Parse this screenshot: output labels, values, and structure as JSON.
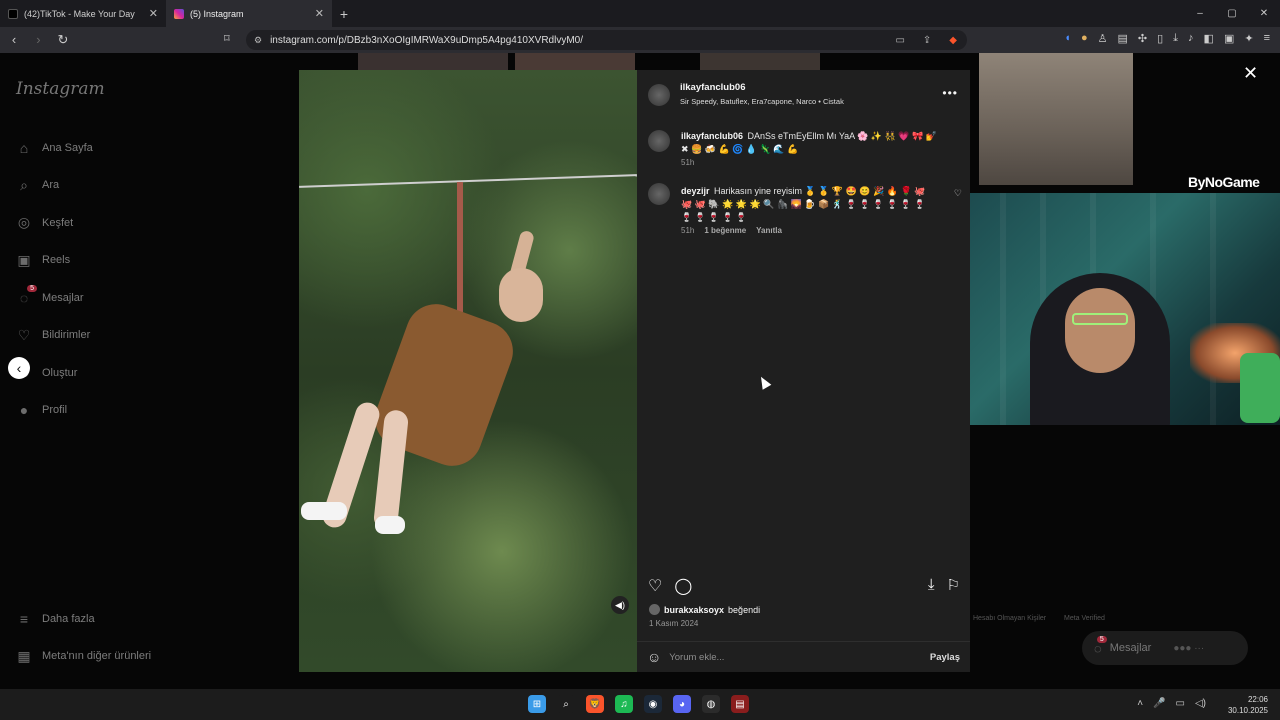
{
  "browser": {
    "tabs": [
      {
        "title": "(42)TikTok - Make Your Day",
        "favicon_color": "#000000",
        "active": false
      },
      {
        "title": "(5) Instagram",
        "favicon_color": "#d6249f",
        "active": true
      }
    ],
    "new_tab": "+",
    "url": "instagram.com/p/DBzb3nXoOIgIMRWaX9uDmp5A4pg410XVRdlvyM0/",
    "window_controls": {
      "minimize": "–",
      "maximize": "▢",
      "close": "✕"
    }
  },
  "sidebar": {
    "logo": "Instagram",
    "items": [
      {
        "label": "Ana Sayfa",
        "icon": "home-icon",
        "glyph": "⌂"
      },
      {
        "label": "Ara",
        "icon": "search-icon",
        "glyph": "⌕"
      },
      {
        "label": "Keşfet",
        "icon": "compass-icon",
        "glyph": "◎"
      },
      {
        "label": "Reels",
        "icon": "reels-icon",
        "glyph": "▣"
      },
      {
        "label": "Mesajlar",
        "icon": "messenger-icon",
        "glyph": "◌",
        "badge": "5"
      },
      {
        "label": "Bildirimler",
        "icon": "heart-icon",
        "glyph": "♡"
      },
      {
        "label": "Oluştur",
        "icon": "create-icon",
        "glyph": "⊕"
      },
      {
        "label": "Profil",
        "icon": "profile-avatar",
        "glyph": "●"
      }
    ],
    "bottom": [
      {
        "label": "Daha fazla",
        "icon": "menu-icon",
        "glyph": "≡"
      },
      {
        "label": "Meta'nın diğer ürünleri",
        "icon": "meta-icon",
        "glyph": "▦"
      }
    ]
  },
  "post": {
    "author": "ilkayfanclub06",
    "collaborators": "Sir Speedy, Batuflex, Era7capone, Narco • Cistak",
    "more": "•••",
    "caption": {
      "user": "ilkayfanclub06",
      "text": "DAnSs eTmEyEllm Mı YaA 🌸 ✨ 👯 💗 🎀 💅 ✖ 🍔 🍻 💪 🌀 💧 🦎 🌊 💪",
      "time": "51h"
    },
    "comments": [
      {
        "user": "deyzijr",
        "text": "Harikasın yine reyisim 🥇 🥇 🏆 🤩 😊 🎉 🔥 🌹 🐙 🐙 🐙 🐘 🌟 🌟 🌟 🔍 🦍 🌄 🍺 📦 🕺 🍷 🍷 🍷 🍷 🍷 🍷 🍷 🍷 🍷 🍷 🍷",
        "time": "51h",
        "likes": "1 beğenme",
        "reply": "Yanıtla"
      }
    ],
    "liked_by_user": "burakxaksoyx",
    "liked_by_suffix": "beğendi",
    "date": "1 Kasım 2024",
    "add_comment_placeholder": "Yorum ekle...",
    "share_label": "Paylaş"
  },
  "background": {
    "watermark": "ByNoGame",
    "footer_links": [
      "Hesabı Olmayan Kişiler",
      "Meta Verified"
    ],
    "messages_pill": "Mesajlar",
    "messages_badge": "5"
  },
  "taskbar": {
    "apps": [
      {
        "name": "windows-start-icon",
        "glyph": "⊞",
        "color": "#3a9be8"
      },
      {
        "name": "search-icon",
        "glyph": "⌕",
        "color": "#1c1c1c"
      },
      {
        "name": "brave-browser-icon",
        "glyph": "🦁",
        "color": "#fb542b"
      },
      {
        "name": "spotify-icon",
        "glyph": "♫",
        "color": "#1db954"
      },
      {
        "name": "steam-icon",
        "glyph": "◉",
        "color": "#1b2838"
      },
      {
        "name": "discord-icon",
        "glyph": "◕",
        "color": "#5865f2"
      },
      {
        "name": "obs-icon",
        "glyph": "◍",
        "color": "#2b2b2b"
      },
      {
        "name": "voicemeeter-icon",
        "glyph": "▤",
        "color": "#8a1d1d"
      }
    ],
    "time": "22:06",
    "date": "30.10.2025"
  }
}
